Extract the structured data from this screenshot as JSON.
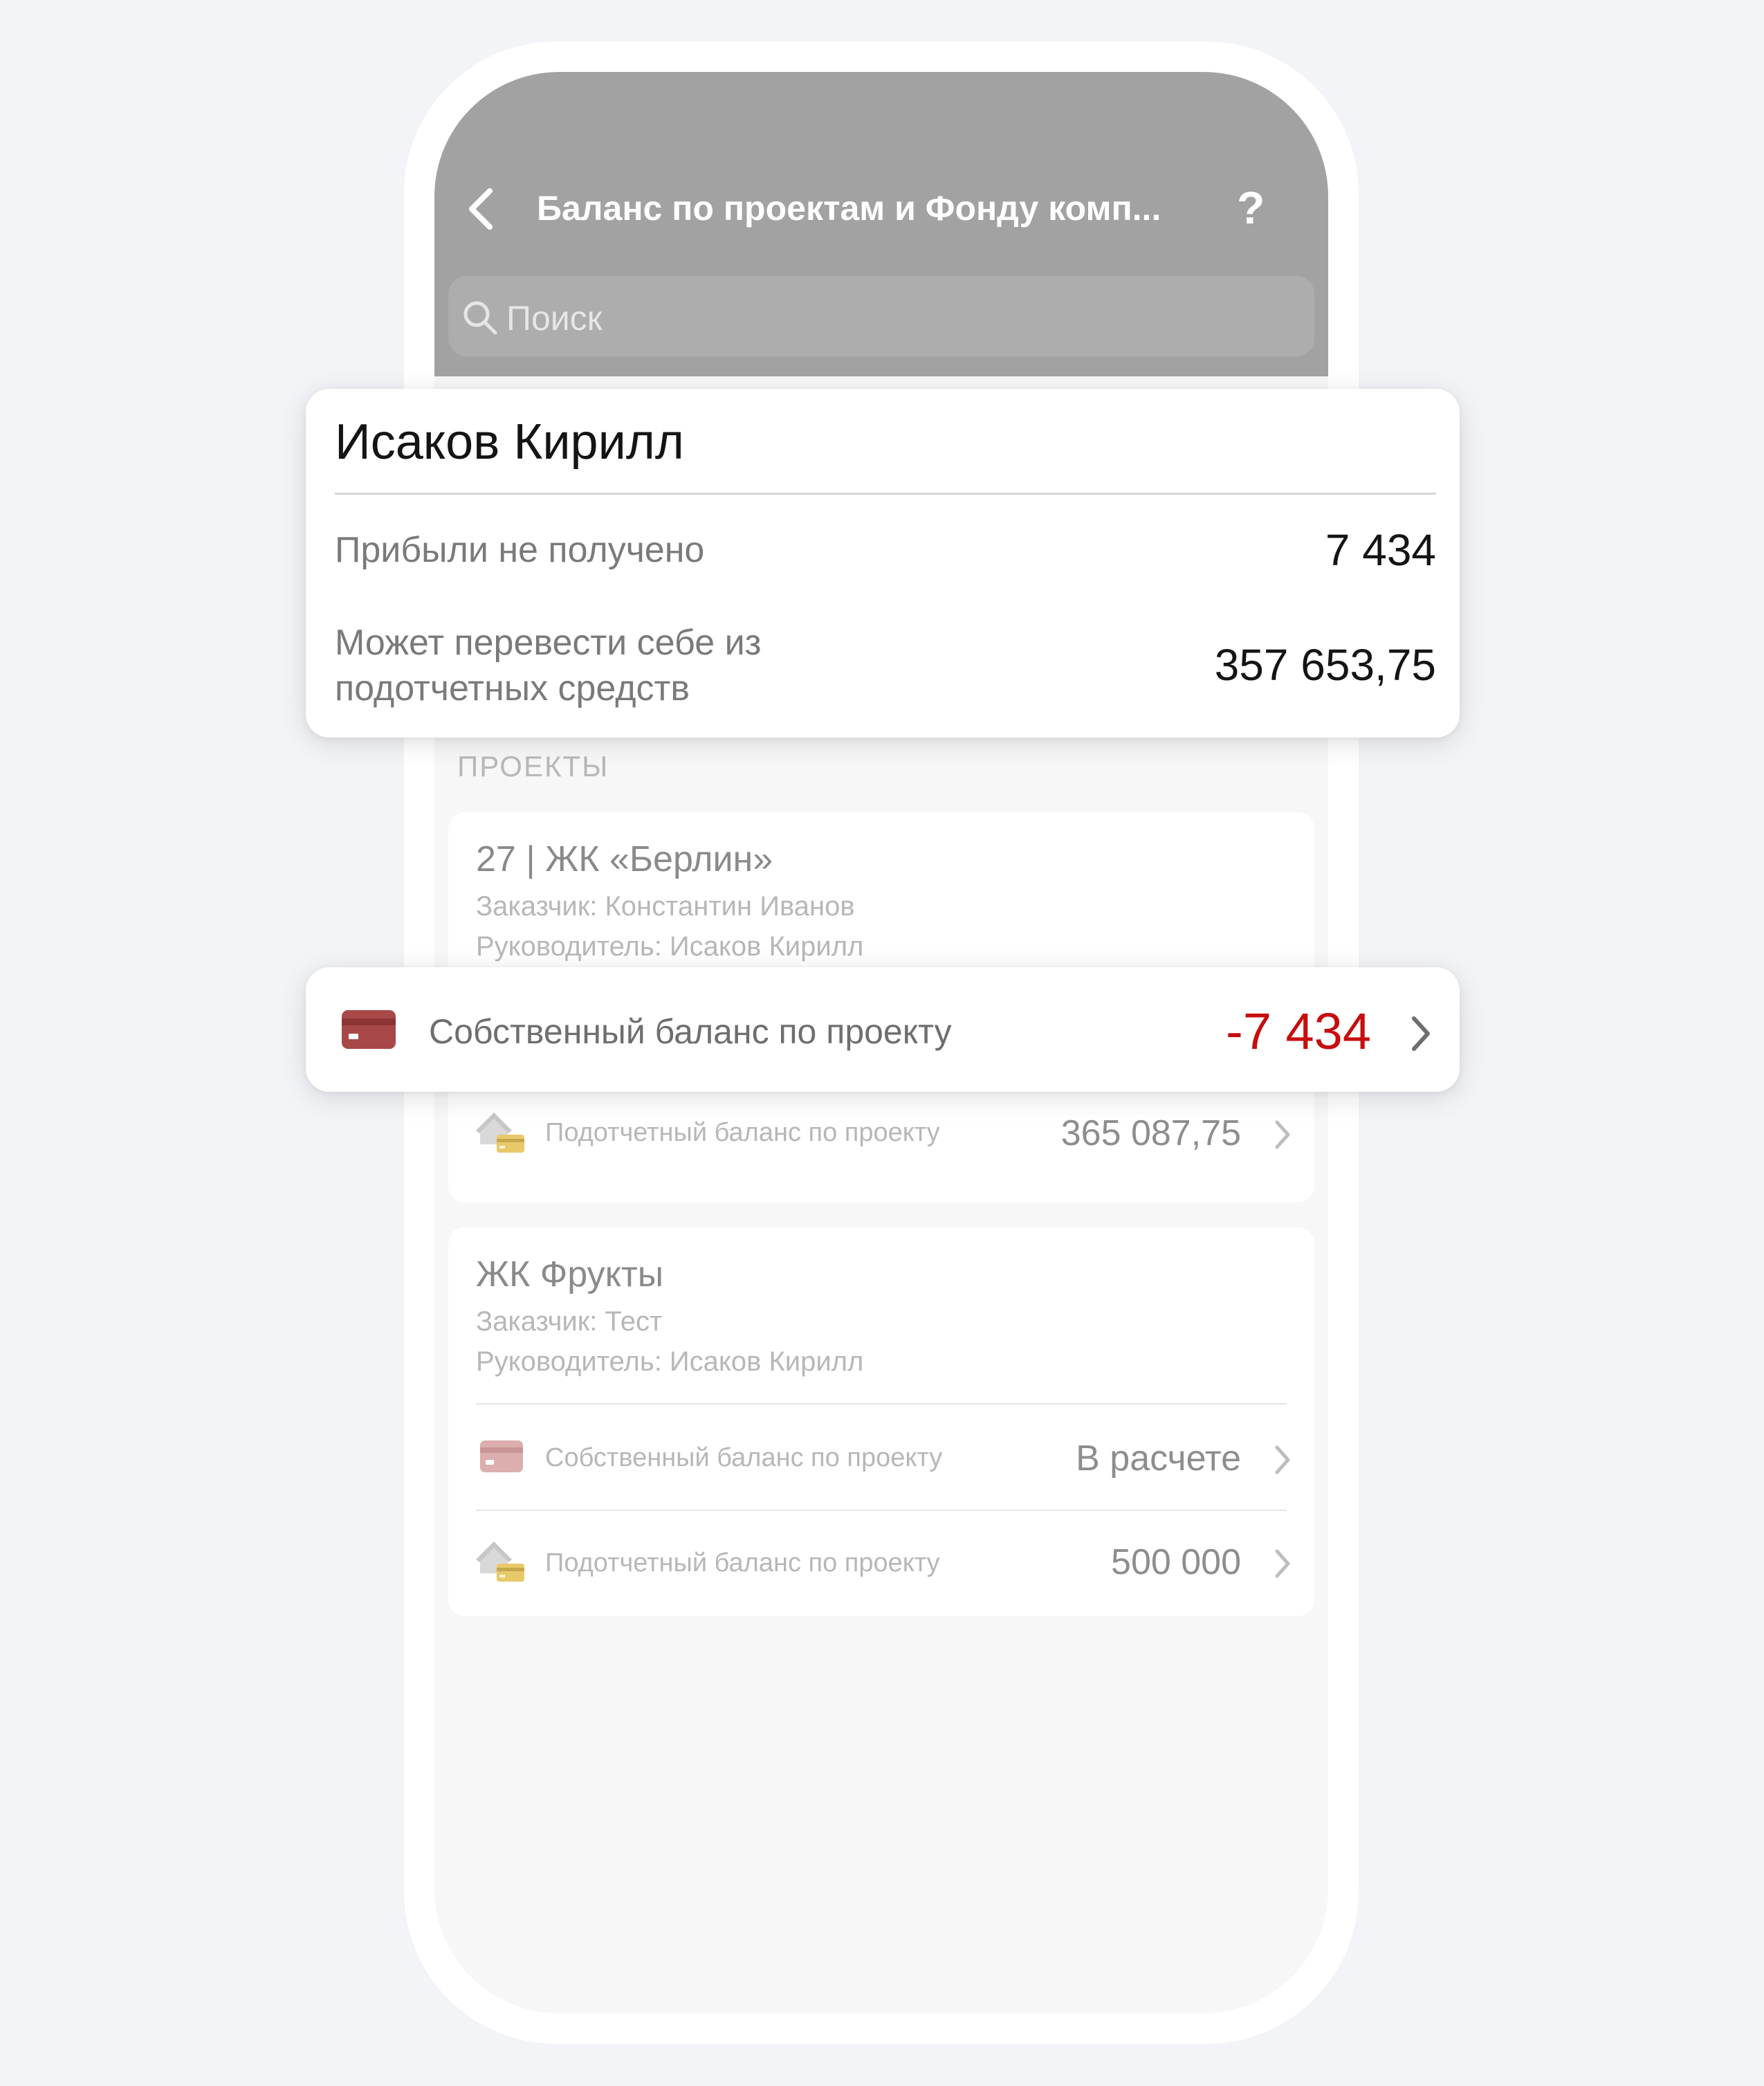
{
  "header": {
    "title": "Баланс по проектам и Фонду комп...",
    "help_label": "?"
  },
  "search": {
    "placeholder": "Поиск"
  },
  "person": {
    "name": "Исаков Кирилл",
    "stats": [
      {
        "label": "Прибыли не получено",
        "value": "7 434"
      },
      {
        "label": "Может перевести себе из подотчетных средств",
        "value": "357 653,75"
      }
    ]
  },
  "projects_section_label": "ПРОЕКТЫ",
  "projects": [
    {
      "title": "27 | ЖК «Берлин»",
      "customer": "Заказчик: Константин Иванов",
      "manager": "Руководитель: Исаков Кирилл",
      "own_balance": {
        "label": "Собственный баланс по проекту",
        "value": "-7 434",
        "icon": "credit-card-icon"
      },
      "accountable_balance": {
        "label": "Подотчетный баланс по проекту",
        "value": "365 087,75",
        "icon": "house-card-icon"
      }
    },
    {
      "title": "ЖК Фрукты",
      "customer": "Заказчик: Тест",
      "manager": "Руководитель: Исаков Кирилл",
      "own_balance": {
        "label": "Собственный баланс по проекту",
        "value": "В расчете",
        "icon": "credit-card-icon"
      },
      "accountable_balance": {
        "label": "Подотчетный баланс по проекту",
        "value": "500 000",
        "icon": "house-card-icon"
      }
    }
  ],
  "colors": {
    "header_bg": "#a2a2a2",
    "negative": "#c70d0d",
    "card_icon": "#a94848",
    "house_card_accent": "#e8c96a"
  }
}
